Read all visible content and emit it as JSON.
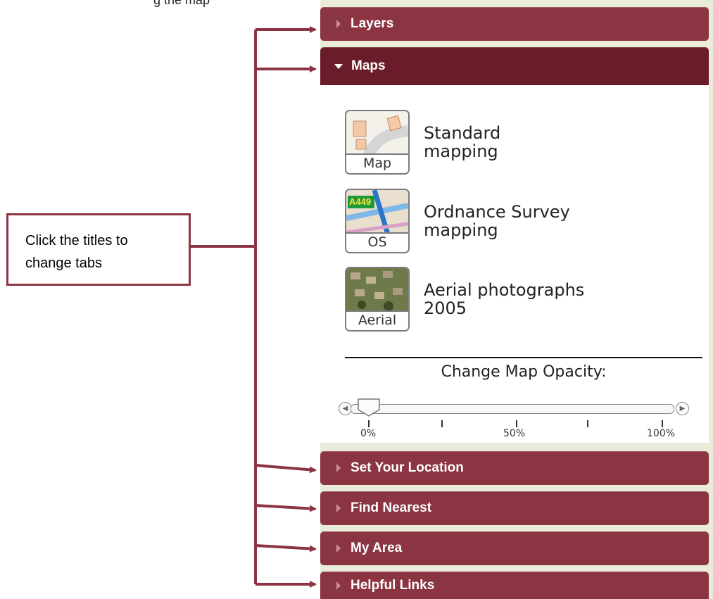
{
  "header_fragment": "g the map",
  "callout": {
    "line1": "Click the titles to",
    "line2": "change tabs"
  },
  "tabs": [
    {
      "label": "Layers",
      "state": "collapsed"
    },
    {
      "label": "Maps",
      "state": "expanded"
    },
    {
      "label": "Set Your Location",
      "state": "collapsed"
    },
    {
      "label": "Find Nearest",
      "state": "collapsed"
    },
    {
      "label": "My Area",
      "state": "collapsed"
    },
    {
      "label": "Helpful Links",
      "state": "collapsed"
    }
  ],
  "maps": {
    "options": [
      {
        "thumb_caption": "Map",
        "line1": "Standard",
        "line2": "mapping"
      },
      {
        "thumb_caption": "OS",
        "line1": "Ordnance Survey",
        "line2": "mapping",
        "badge": "A449"
      },
      {
        "thumb_caption": "Aerial",
        "line1": "Aerial photographs",
        "line2": "2005"
      }
    ],
    "opacity_label": "Change Map Opacity:",
    "opacity_value_percent": 0,
    "ticks": [
      "0%",
      "50%",
      "100%"
    ]
  },
  "colors": {
    "tab": "#8b3442",
    "tab_open": "#6b1c2a",
    "arrow": "#8b3442"
  }
}
